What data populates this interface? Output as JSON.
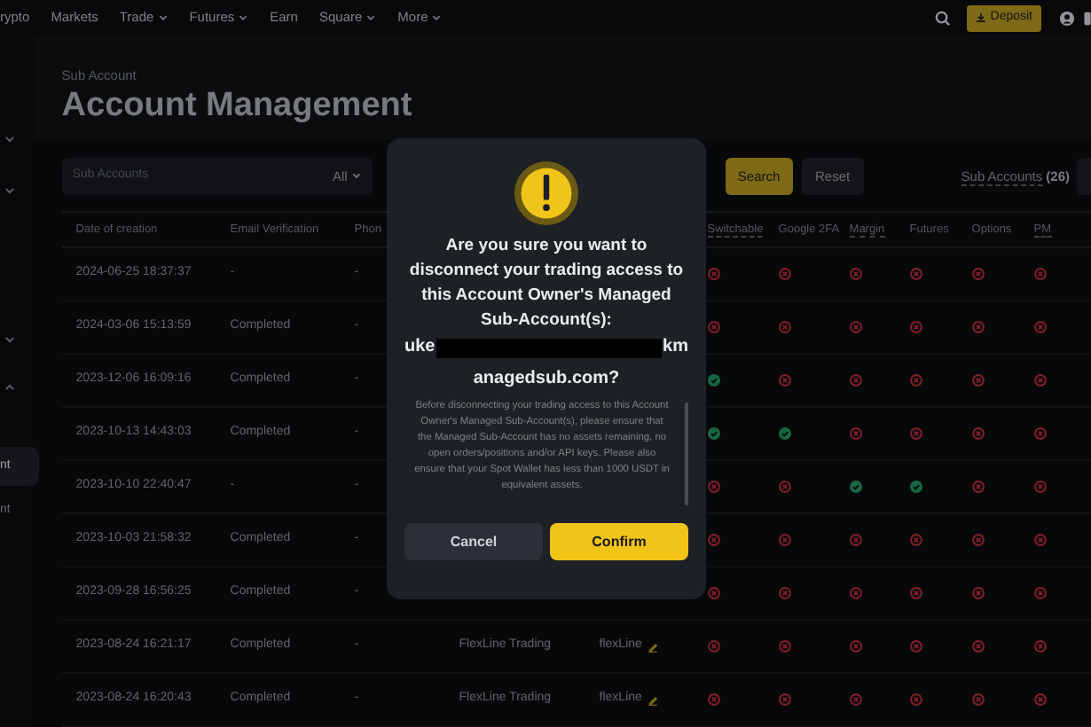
{
  "nav": {
    "items": [
      {
        "label": "rypto",
        "dropdown": false
      },
      {
        "label": "Markets",
        "dropdown": false
      },
      {
        "label": "Trade",
        "dropdown": true
      },
      {
        "label": "Futures",
        "dropdown": true
      },
      {
        "label": "Earn",
        "dropdown": false
      },
      {
        "label": "Square",
        "dropdown": true
      },
      {
        "label": "More",
        "dropdown": true
      }
    ],
    "deposit": "Deposit"
  },
  "sidebar": {
    "items": [
      {
        "label": "nt",
        "selected": true
      },
      {
        "label": "nt",
        "selected": false
      }
    ]
  },
  "page": {
    "breadcrumb": "Sub Account",
    "title": "Account Management"
  },
  "filters": {
    "search_placeholder": "Sub Accounts",
    "type_filter": "All",
    "search_button": "Search",
    "reset_button": "Reset",
    "count_label": "Sub Accounts",
    "count": "(26)"
  },
  "table": {
    "columns": [
      "Date of creation",
      "Email Verification",
      "Phon",
      "",
      "",
      "Switchable",
      "Google 2FA",
      "Margin",
      "Futures",
      "Options",
      "PM"
    ],
    "rows": [
      {
        "date": "2024-06-25 18:37:37",
        "email": "-",
        "phone": "-",
        "flags": [
          false,
          false,
          false,
          false,
          false,
          false
        ]
      },
      {
        "date": "2024-03-06 15:13:59",
        "email": "Completed",
        "phone": "-",
        "flags": [
          false,
          false,
          false,
          false,
          false,
          false
        ]
      },
      {
        "date": "2023-12-06 16:09:16",
        "email": "Completed",
        "phone": "-",
        "flags": [
          true,
          false,
          false,
          false,
          false,
          false
        ]
      },
      {
        "date": "2023-10-13 14:43:03",
        "email": "Completed",
        "phone": "-",
        "flags": [
          true,
          true,
          false,
          false,
          false,
          false
        ]
      },
      {
        "date": "2023-10-10 22:40:47",
        "email": "-",
        "phone": "-",
        "flags": [
          false,
          false,
          true,
          true,
          false,
          false
        ]
      },
      {
        "date": "2023-10-03 21:58:32",
        "email": "Completed",
        "phone": "-",
        "flags": [
          false,
          false,
          false,
          false,
          false,
          false
        ]
      },
      {
        "date": "2023-09-28 16:56:25",
        "email": "Completed",
        "phone": "-",
        "flags": [
          false,
          false,
          false,
          false,
          false,
          false
        ]
      },
      {
        "date": "2023-08-24 16:21:17",
        "email": "Completed",
        "phone": "-",
        "column_4": "FlexLine Trading",
        "column_5": "flexLine",
        "flags": [
          false,
          false,
          false,
          false,
          false,
          false
        ]
      },
      {
        "date": "2023-08-24 16:20:43",
        "email": "Completed",
        "phone": "-",
        "column_4": "FlexLine Trading",
        "column_5": "flexLine",
        "flags": [
          false,
          false,
          false,
          false,
          false,
          false
        ]
      }
    ]
  },
  "dialog": {
    "title": "Are you sure you want to disconnect your trading access to this Account Owner's Managed Sub-Account(s):",
    "email_start": "uke",
    "email_end": "km",
    "email_rest": "anagedsub.com?",
    "body": "Before disconnecting your trading access to this Account Owner's Managed Sub-Account(s), please ensure that the Managed Sub-Account has no assets remaining, no open orders/positions and/or API keys. Please also ensure that your Spot Wallet has less than 1000 USDT in equivalent assets.",
    "buttons": [
      {
        "label": "Cancel",
        "kind": "secondary"
      },
      {
        "label": "Confirm",
        "kind": "primary"
      }
    ]
  }
}
